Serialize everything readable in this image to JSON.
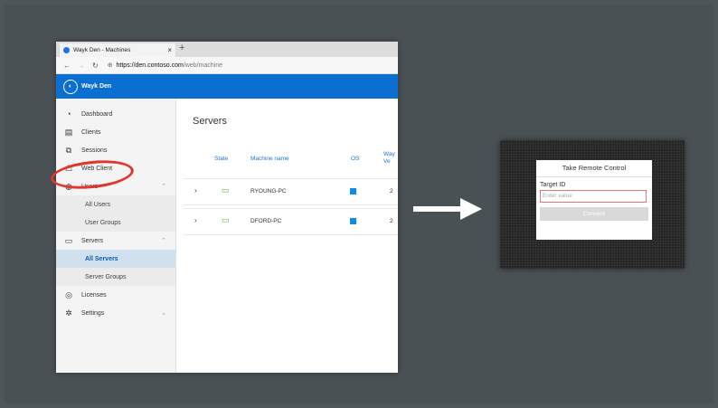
{
  "browser": {
    "tab_title": "Wayk Den - Machines",
    "tab_close": "×",
    "new_tab": "+",
    "back": "←",
    "forward": "→",
    "refresh": "↻",
    "url_host": "https://den.contoso.com",
    "url_path": "/web/machine"
  },
  "app": {
    "brand": "Wayk Den",
    "accent_color": "#0a6fd1"
  },
  "sidebar": {
    "dashboard": "Dashboard",
    "clients": "Clients",
    "sessions": "Sessions",
    "web_client": "Web Client",
    "users": "Users",
    "all_users": "All Users",
    "user_groups": "User Groups",
    "servers": "Servers",
    "all_servers": "All Servers",
    "server_groups": "Server Groups",
    "licenses": "Licenses",
    "settings": "Settings"
  },
  "main": {
    "title": "Servers",
    "columns": [
      "State",
      "Machine name",
      "OS",
      "Way Ve"
    ],
    "rows": [
      {
        "name": "RYOUNG-PC",
        "ver": "2"
      },
      {
        "name": "DFORD-PC",
        "ver": "2"
      }
    ]
  },
  "remote": {
    "title": "Take Remote Control",
    "label": "Target ID",
    "placeholder": "Enter value",
    "button": "Connect"
  },
  "annotation": {
    "highlight_color": "#e1362c"
  }
}
